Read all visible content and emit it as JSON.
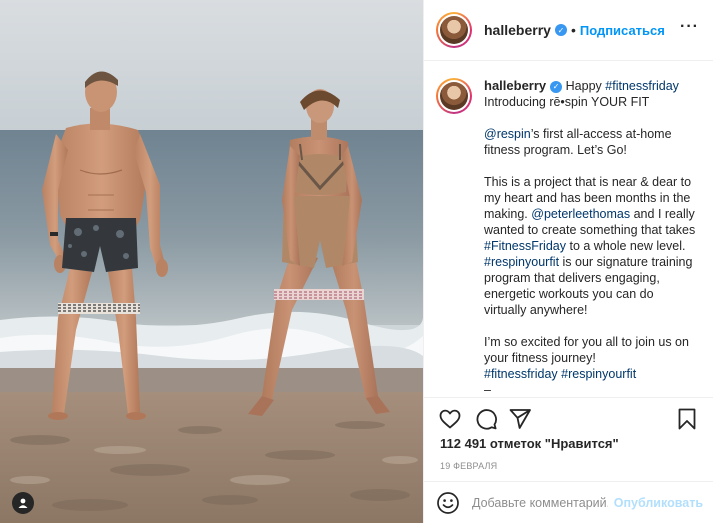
{
  "post": {
    "author": "halleberry",
    "follow_label": "Подписаться",
    "dot": "•",
    "more_label": "···"
  },
  "caption": {
    "username": "halleberry",
    "line1_text": "Happy",
    "line1_tag": "#fitnessfriday",
    "line2": "Introducing rē•spin YOUR FIT",
    "p2_mention": "@respin",
    "p2_text": "’s first all-access at-home fitness program.  Let’s Go!",
    "p3_a": "This is a project that is near & dear to my heart and has been months in the making.",
    "p3_mention": "@peterleethomas",
    "p3_b": "and I really wanted to create something that takes",
    "p3_tag1": "#FitnessFriday",
    "p3_c": "to a whole new level.",
    "p3_tag2": "#respinyourfit",
    "p3_d": "is our signature training program that delivers engaging, energetic workouts you can do virtually anywhere!",
    "p4_text": "I’m so excited for you all to join us on your fitness journey!",
    "p4_tag1": "#fitnessfriday",
    "p4_tag2": "#respinyourfit",
    "p5": "–"
  },
  "stats": {
    "likes": "112 491 отметок \"Нравится\"",
    "date": "19 ФЕВРАЛЯ"
  },
  "comment": {
    "placeholder": "Добавьте комментарий...",
    "publish_label": "Опубликовать"
  },
  "icons": {
    "like": "heart-icon",
    "comment": "comment-icon",
    "share": "paper-plane-icon",
    "save": "bookmark-icon",
    "emoji": "smiley-icon",
    "tag": "user-tag-icon",
    "verified": "verified-badge-icon"
  },
  "colors": {
    "link": "#00376b",
    "follow": "#0095f6",
    "publish_disabled": "#b2dffc",
    "verified": "#3897f0",
    "muted": "#8e8e8e"
  }
}
